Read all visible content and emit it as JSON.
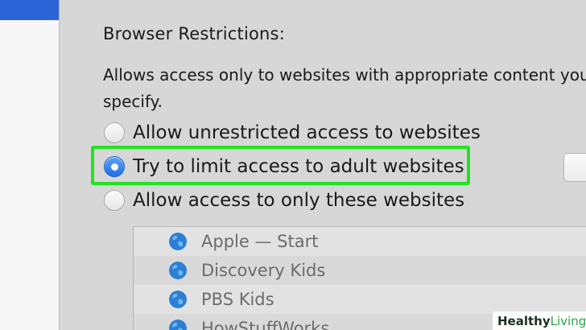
{
  "browser_restrictions": {
    "heading": "Browser Restrictions:",
    "description": "Allows access only to websites with appropriate content you specify.",
    "options": [
      {
        "label": "Allow unrestricted access to websites",
        "selected": false
      },
      {
        "label": "Try to limit access to adult websites",
        "selected": true
      },
      {
        "label": "Allow access to only these websites",
        "selected": false
      }
    ],
    "sites": [
      {
        "name": "Apple — Start",
        "icon": "globe-icon"
      },
      {
        "name": "Discovery Kids",
        "icon": "globe-icon"
      },
      {
        "name": "PBS Kids",
        "icon": "globe-icon"
      },
      {
        "name": "HowStuffWorks",
        "icon": "globe-icon"
      }
    ]
  },
  "watermark": {
    "part1": "Healthy",
    "part2": "Living",
    "icon": "plus-cross-icon"
  },
  "colors": {
    "accent_blue": "#2c64d8",
    "highlight_green": "#22e31f",
    "background": "#d7d7d7"
  }
}
